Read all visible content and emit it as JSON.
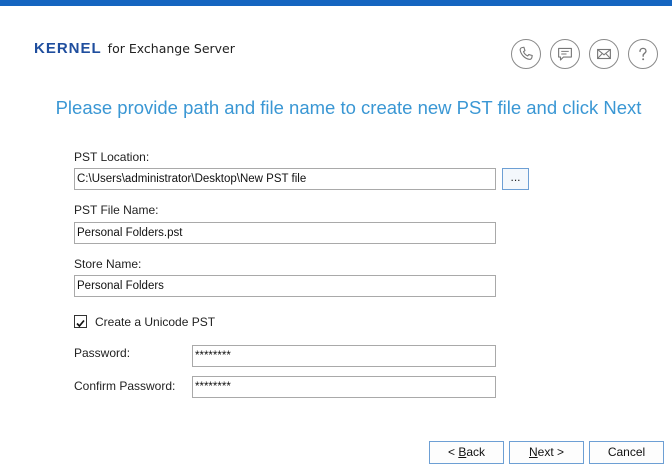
{
  "header": {
    "brand_name": "KERNEL",
    "brand_sub": "for Exchange Server",
    "brand_color": "#1f4e9e",
    "accent_color": "#1565c0",
    "icons": [
      "phone-icon",
      "chat-icon",
      "mail-icon",
      "help-icon"
    ]
  },
  "heading": "Please provide path and file name to create new PST file and click Next",
  "form": {
    "pst_location_label": "PST Location:",
    "pst_location_value": "C:\\Users\\administrator\\Desktop\\New PST file",
    "browse_label": "...",
    "pst_file_name_label": "PST File Name:",
    "pst_file_name_value": "Personal Folders.pst",
    "store_name_label": "Store Name:",
    "store_name_value": "Personal Folders",
    "unicode_label": "Create a Unicode PST",
    "unicode_checked": true,
    "password_label": "Password:",
    "password_value": "********",
    "confirm_password_label": "Confirm Password:",
    "confirm_password_value": "********"
  },
  "footer": {
    "back_prefix": "< ",
    "back_mnemonic": "B",
    "back_rest": "ack",
    "next_mnemonic": "N",
    "next_rest": "ext >",
    "cancel_label": "Cancel"
  }
}
